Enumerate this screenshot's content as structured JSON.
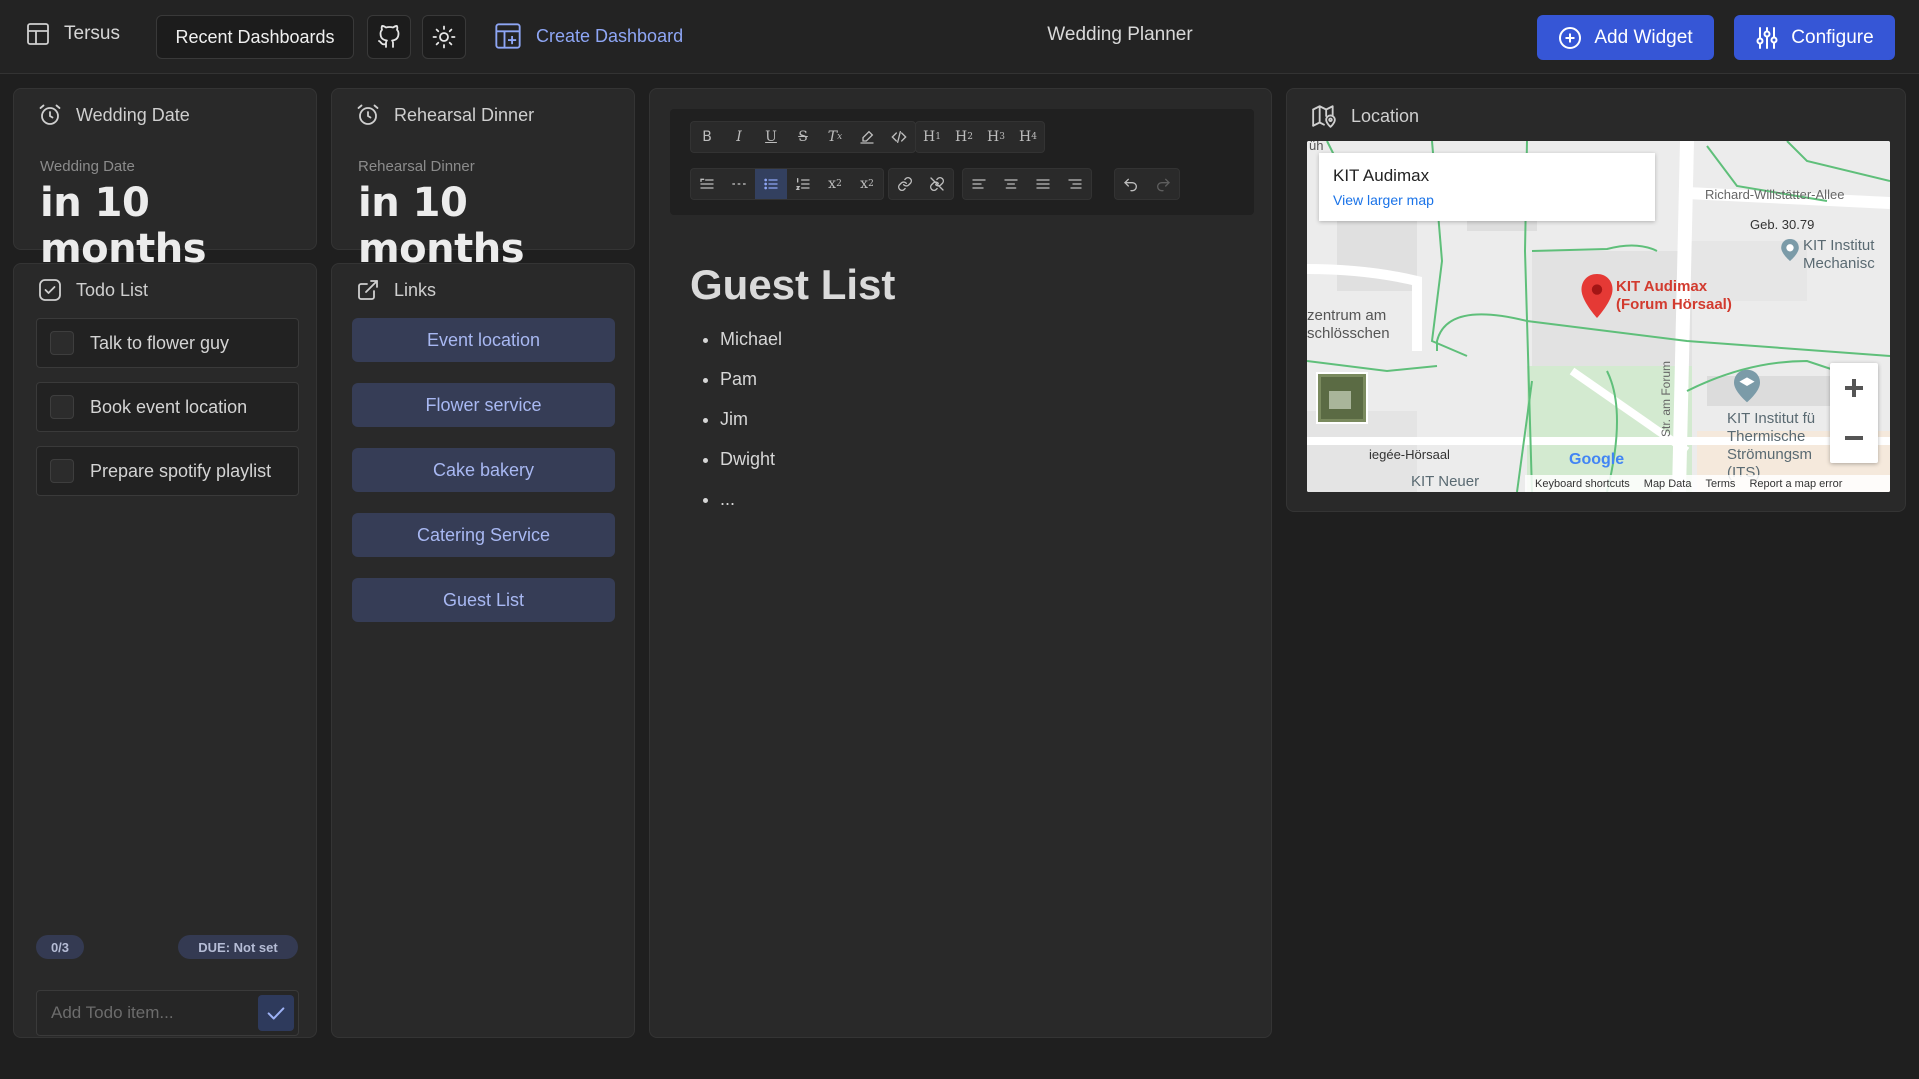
{
  "header": {
    "brand": "Tersus",
    "recent_dashboards": "Recent Dashboards",
    "create_dashboard": "Create Dashboard",
    "page_title": "Wedding Planner",
    "add_widget": "Add Widget",
    "configure": "Configure"
  },
  "wedding_date": {
    "title": "Wedding Date",
    "label": "Wedding Date",
    "value": "in 10 months"
  },
  "rehearsal_dinner": {
    "title": "Rehearsal Dinner",
    "label": "Rehearsal Dinner",
    "value": "in 10 months"
  },
  "todo": {
    "title": "Todo List",
    "items": [
      "Talk to flower guy",
      "Book event location",
      "Prepare spotify playlist"
    ],
    "progress": "0/3",
    "due": "DUE: Not set",
    "placeholder": "Add Todo item..."
  },
  "links": {
    "title": "Links",
    "items": [
      "Event location",
      "Flower service",
      "Cake bakery",
      "Catering Service",
      "Guest List"
    ]
  },
  "editor": {
    "toolbar_row1": [
      "B",
      "I",
      "U",
      "S",
      "Tx",
      "highlight",
      "code",
      "H1",
      "H2",
      "H3",
      "H4"
    ],
    "heading": "Guest List",
    "list": [
      "Michael",
      "Pam",
      "Jim",
      "Dwight",
      "..."
    ]
  },
  "location": {
    "title": "Location",
    "place_name": "KIT Audimax",
    "view_larger": "View larger map",
    "marker_label_1": "KIT Audimax",
    "marker_label_2": "(Forum Hörsaal)",
    "street_1": "Richard-Willstätter-Allee",
    "building": "Geb. 30.79",
    "label_left_1": "zentrum am",
    "label_left_2": "schlösschen",
    "label_inst_1": "KIT Institut",
    "label_inst_2": "Mechanisc",
    "label_inst_3": "KIT Institut fü",
    "label_inst_4": "Thermische",
    "label_inst_5": "Strömungsm",
    "label_inst_6": "(ITS)",
    "label_gaede": "iegée-Hörsaal",
    "label_neuer": "KIT Neuer",
    "label_street_vert": "Str. am Forum",
    "label_top_left": "üh",
    "google": "Google",
    "footer": [
      "Keyboard shortcuts",
      "Map Data",
      "Terms",
      "Report a map error"
    ]
  }
}
